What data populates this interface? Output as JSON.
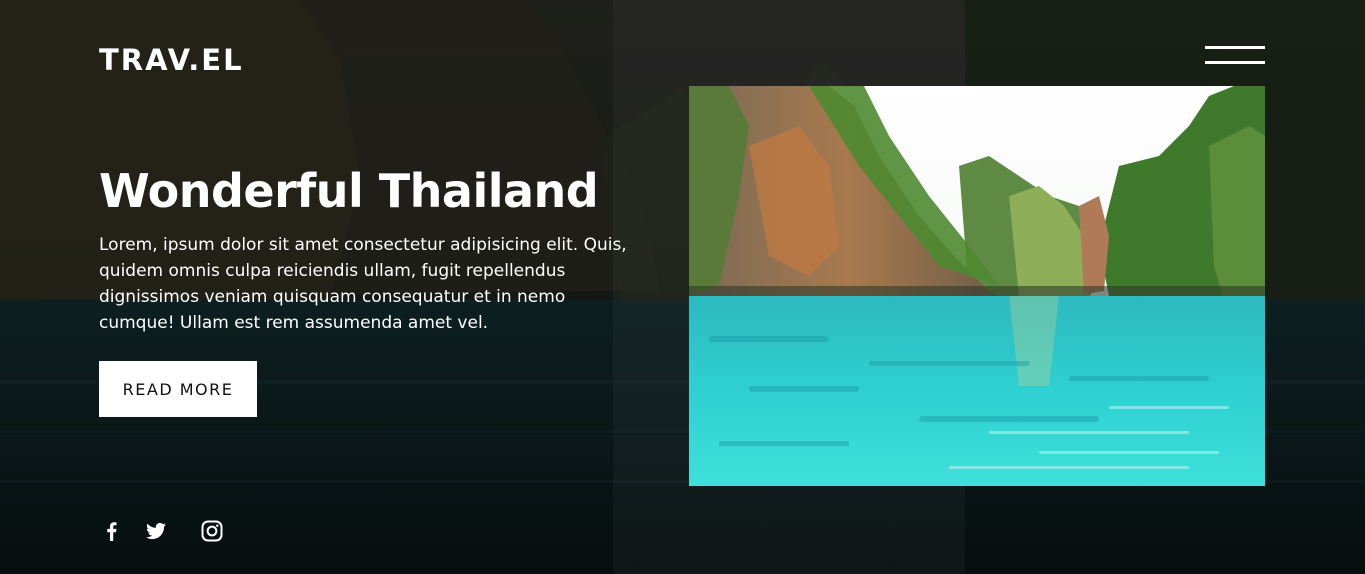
{
  "brand": {
    "logo": "TRAV.EL"
  },
  "hero": {
    "title": "Wonderful Thailand",
    "description": "Lorem, ipsum dolor sit amet consectetur adipisicing elit. Quis, quidem omnis culpa reiciendis ullam, fugit repellendus dignissimos veniam quisquam consequatur et in nemo cumque! Ullam est rem assumenda amet vel.",
    "button_label": "READ MORE"
  },
  "menu": {
    "icon": "hamburger-menu-icon"
  },
  "social": [
    {
      "icon": "facebook-icon"
    },
    {
      "icon": "twitter-icon"
    },
    {
      "icon": "instagram-icon"
    }
  ],
  "colors": {
    "text": "#ffffff",
    "button_bg": "#ffffff",
    "button_text": "#111111",
    "water": "#2fc7c9",
    "background": "#0d1a1c"
  }
}
